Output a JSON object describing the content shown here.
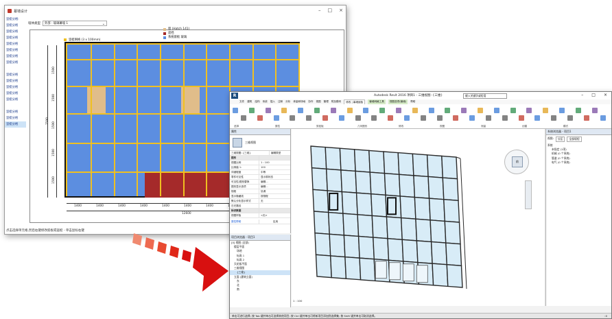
{
  "window1": {
    "title": "幕墙设计",
    "controls": [
      "–",
      "□",
      "×"
    ],
    "sidebar": {
      "items": [
        "竖梃分格:",
        "竖梃分格",
        "竖梃分格",
        "竖梃分格",
        "竖梃分格",
        "竖梃分格",
        "竖梃分格",
        "竖梃分格",
        "",
        "竖梃分格",
        "竖梃分格",
        "竖梃分格",
        "竖梃分格",
        "竖梃分格",
        "",
        "竖梃分格",
        "竖梃分格",
        "竖梃分格"
      ]
    },
    "type_label": "墙体类型",
    "type_value": "外部 - 玻璃幕墙 1",
    "legend": [
      {
        "label": "窗 (Hatch 141)",
        "color": "#e0bd8a"
      },
      {
        "label": "遮挡",
        "color": "#a52a2a"
      },
      {
        "label": "系统嵌板 玻璃",
        "color": "#5c8ee0"
      }
    ],
    "legend_grid": "竖梃网格 (3 x 100mm)",
    "grid_line_color": "#f0c020",
    "panel_color": "#5c8ee0",
    "dims_left": [
      "1500",
      "1500",
      "1500",
      "1500",
      "1500"
    ],
    "dim_total_left": "7500",
    "dims_bottom": [
      "1400",
      "1400",
      "1400",
      "1400",
      "1400",
      "1400",
      "1400",
      "1400",
      "1400"
    ],
    "dim_total_bottom": "12600",
    "status": "点击选择单元格,然后右键修改嵌板或竖梃 - 单击鼠标右键"
  },
  "window2": {
    "title": "Autodesk Revit 2016    项目1 - 三维视图: {三维}",
    "search_placeholder": "键入关键字或短语",
    "window_controls": [
      "–",
      "□",
      "×"
    ],
    "ribbon_tabs": [
      "文件",
      "建筑",
      "结构",
      "系统",
      "插入",
      "注释",
      "分析",
      "体量和场地",
      "协作",
      "视图",
      "管理",
      "附加模块",
      "修改 | 幕墙嵌板",
      "幕墙网格工具",
      "视图选项(幕墙)",
      "帮助"
    ],
    "active_tab": "修改 | 幕墙嵌板",
    "ribbon_groups": [
      "选择",
      "属性",
      "剪贴板",
      "几何图形",
      "修改",
      "视图",
      "测量",
      "创建",
      "模式"
    ],
    "properties": {
      "header": "属性",
      "type_name": "三维视图",
      "dropdown": "三维视图: {三维}",
      "edit_type": "编辑类型",
      "rows": [
        {
          "k": "图形",
          "v": "",
          "sec": true
        },
        {
          "k": "视图比例",
          "v": "1 : 100"
        },
        {
          "k": "比例值 1:",
          "v": "100"
        },
        {
          "k": "详细程度",
          "v": "中等"
        },
        {
          "k": "零件可见性",
          "v": "显示原状态"
        },
        {
          "k": "可见性/图形替换",
          "v": "编辑..."
        },
        {
          "k": "图形显示选项",
          "v": "编辑..."
        },
        {
          "k": "规程",
          "v": "协调"
        },
        {
          "k": "显示隐藏线",
          "v": "按规程"
        },
        {
          "k": "默认分析显示样式",
          "v": "无"
        },
        {
          "k": "日光路径",
          "v": ""
        },
        {
          "k": "标识数据",
          "v": "",
          "sec": true
        },
        {
          "k": "视图样板",
          "v": "<无>"
        }
      ],
      "help_link": "属性帮助",
      "apply": "应用"
    },
    "browser": {
      "header": "项目浏览器 - 项目1",
      "items": [
        "[0] 视图 (全部)",
        "楼层平面",
        "场地",
        "标高 1",
        "标高 2",
        "天花板平面",
        "三维视图",
        "{三维}",
        "立面 (建筑立面)",
        "东",
        "北",
        "南"
      ]
    },
    "viewport_label": "1 : 100",
    "viewcube_face": "前",
    "project_panel": {
      "header": "系统浏览器 - 项目1",
      "view_label": "视图:",
      "view_value": "分区",
      "units": "全部规程",
      "items": [
        "系统",
        "未指定 (1项)",
        "机械 (0 个系统)",
        "管道 (0 个系统)",
        "电气 (0 个系统)"
      ]
    },
    "status": "单击可进行选择; 按 Tab 键并单击可选择其他项目; 按 Ctrl 键并单击可将新项目添加到选择集; 按 Shift 键并单击可取消选择。",
    "status_right": ":0"
  },
  "arrow_colors": [
    "#f08a70",
    "#ee6a50",
    "#e84a30",
    "#e02818",
    "#d81010"
  ]
}
